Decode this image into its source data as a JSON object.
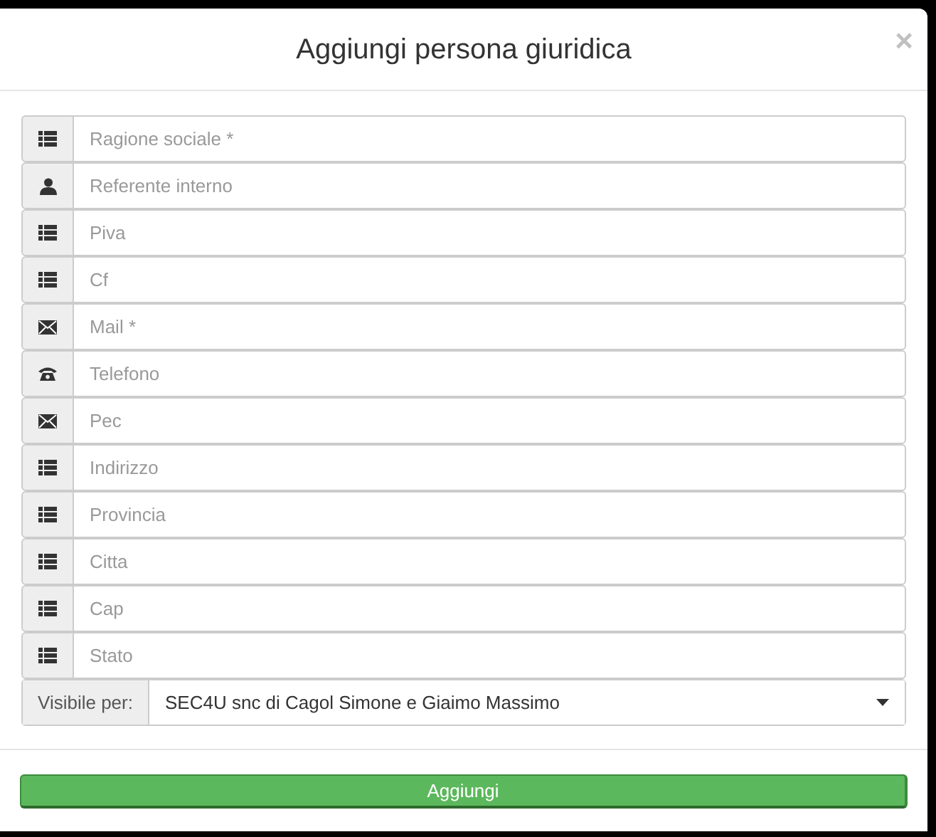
{
  "dialog": {
    "title": "Aggiungi persona giuridica",
    "close": "×"
  },
  "fields": [
    {
      "kind": "list",
      "placeholder": "Ragione sociale *"
    },
    {
      "kind": "user",
      "placeholder": "Referente interno"
    },
    {
      "kind": "list",
      "placeholder": "Piva"
    },
    {
      "kind": "list",
      "placeholder": "Cf"
    },
    {
      "kind": "envelope",
      "placeholder": "Mail *"
    },
    {
      "kind": "phone",
      "placeholder": "Telefono"
    },
    {
      "kind": "envelope",
      "placeholder": "Pec"
    },
    {
      "kind": "list",
      "placeholder": "Indirizzo"
    },
    {
      "kind": "list",
      "placeholder": "Provincia"
    },
    {
      "kind": "list",
      "placeholder": "Citta"
    },
    {
      "kind": "list",
      "placeholder": "Cap"
    },
    {
      "kind": "list",
      "placeholder": "Stato"
    }
  ],
  "visibility": {
    "label": "Visibile per:",
    "value": "SEC4U snc di Cagol Simone e Giaimo Massimo"
  },
  "submit": "Aggiungi"
}
